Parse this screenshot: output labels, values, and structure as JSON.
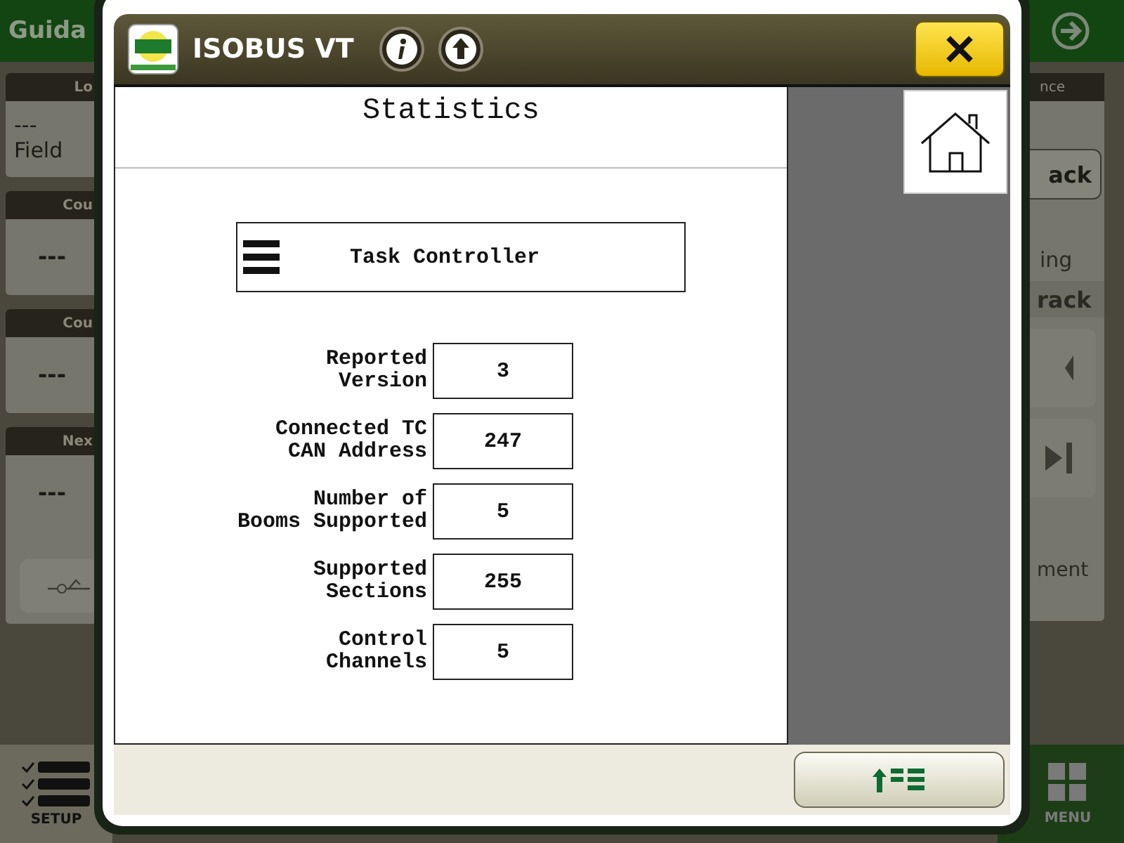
{
  "background": {
    "title": "Guida",
    "left_cards": [
      {
        "header": "Lo",
        "lines": [
          "---",
          "Field"
        ]
      },
      {
        "header": "Cou",
        "lines": [
          "---"
        ]
      },
      {
        "header": "Cou",
        "lines": [
          "---"
        ]
      },
      {
        "header": "Nex",
        "lines": [
          "---"
        ]
      }
    ],
    "right_panel": {
      "header": "nce",
      "button": "ack",
      "status": "ing",
      "section": "rack",
      "footer": "ment"
    },
    "setup": "SETUP",
    "menu": "MENU"
  },
  "dialog": {
    "title": "ISOBUS VT",
    "page_title": "Statistics",
    "section": "Task Controller",
    "stats": [
      {
        "label": [
          "Reported",
          "Version"
        ],
        "value": "3"
      },
      {
        "label": [
          "Connected TC",
          "CAN Address"
        ],
        "value": "247"
      },
      {
        "label": [
          "Number of",
          "Booms Supported"
        ],
        "value": "5"
      },
      {
        "label": [
          "Supported",
          "Sections"
        ],
        "value": "255"
      },
      {
        "label": [
          "Control",
          "Channels"
        ],
        "value": "5"
      }
    ]
  }
}
